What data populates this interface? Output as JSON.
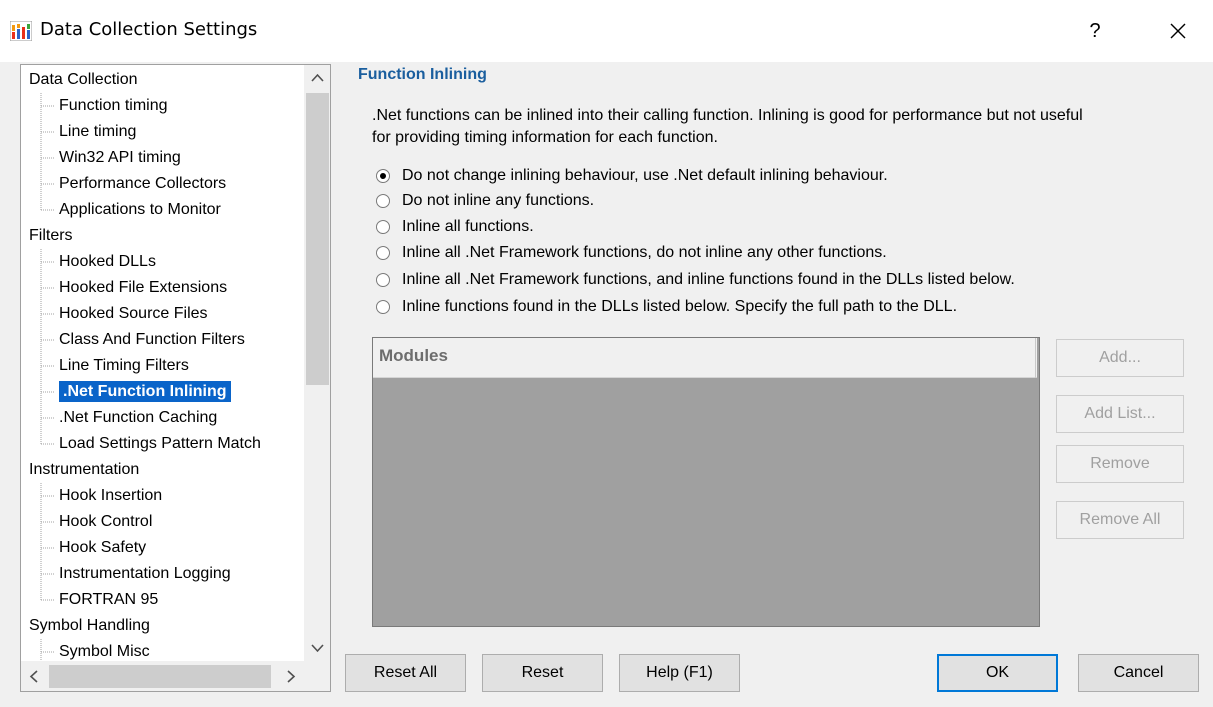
{
  "window": {
    "title": "Data Collection Settings",
    "help_label": "?",
    "icon": "bar-chart-app-icon"
  },
  "tree": {
    "rows": [
      {
        "label": "Data Collection",
        "level": 0
      },
      {
        "label": "Function timing",
        "level": 1
      },
      {
        "label": "Line timing",
        "level": 1
      },
      {
        "label": "Win32 API timing",
        "level": 1
      },
      {
        "label": "Performance Collectors",
        "level": 1
      },
      {
        "label": "Applications to Monitor",
        "level": 1
      },
      {
        "label": "Filters",
        "level": 0
      },
      {
        "label": "Hooked DLLs",
        "level": 1
      },
      {
        "label": "Hooked File Extensions",
        "level": 1
      },
      {
        "label": "Hooked Source Files",
        "level": 1
      },
      {
        "label": "Class And Function Filters",
        "level": 1
      },
      {
        "label": "Line Timing Filters",
        "level": 1
      },
      {
        "label": ".Net Function Inlining",
        "level": 1,
        "selected": true
      },
      {
        "label": ".Net Function Caching",
        "level": 1
      },
      {
        "label": "Load Settings Pattern Match",
        "level": 1
      },
      {
        "label": "Instrumentation",
        "level": 0
      },
      {
        "label": "Hook Insertion",
        "level": 1
      },
      {
        "label": "Hook Control",
        "level": 1
      },
      {
        "label": "Hook Safety",
        "level": 1
      },
      {
        "label": "Instrumentation Logging",
        "level": 1
      },
      {
        "label": "FORTRAN 95",
        "level": 1
      },
      {
        "label": "Symbol Handling",
        "level": 0
      },
      {
        "label": "Symbol Misc",
        "level": 1
      }
    ],
    "scroll_up": "^",
    "scroll_down": "v",
    "scroll_left": "<",
    "scroll_right": ">"
  },
  "panel": {
    "title": "Function Inlining",
    "description_line1": ".Net functions can be inlined into their calling function. Inlining is good for performance but not useful",
    "description_line2": "for providing timing information for each function.",
    "options": [
      {
        "label": "Do not change inlining behaviour, use .Net default inlining behaviour.",
        "checked": true
      },
      {
        "label": "Do not inline any functions.",
        "checked": false
      },
      {
        "label": "Inline all functions.",
        "checked": false
      },
      {
        "label": "Inline all .Net Framework functions, do not inline any other functions.",
        "checked": false
      },
      {
        "label": "Inline all .Net Framework functions, and inline functions found in the DLLs listed below.",
        "checked": false
      },
      {
        "label": "Inline functions found in the DLLs listed below. Specify the full path to the DLL.",
        "checked": false
      }
    ],
    "modules_header": "Modules",
    "buttons": {
      "add": "Add...",
      "add_list": "Add List...",
      "remove": "Remove",
      "remove_all": "Remove All"
    }
  },
  "footer": {
    "reset_all": "Reset All",
    "reset": "Reset",
    "help": "Help (F1)",
    "ok": "OK",
    "cancel": "Cancel"
  },
  "colors": {
    "selection": "#0a64c9",
    "section_title": "#1a5e9e",
    "modules_bg": "#a0a0a0",
    "default_button_border": "#0078d7"
  }
}
